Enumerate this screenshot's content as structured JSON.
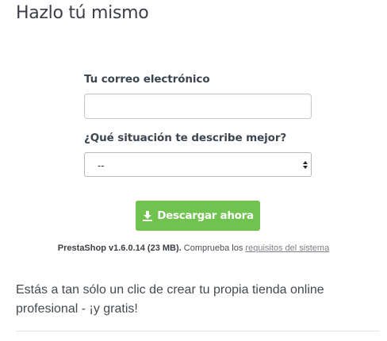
{
  "page": {
    "title": "Hazlo tú mismo"
  },
  "form": {
    "email_label": "Tu correo electrónico",
    "email_value": "",
    "email_placeholder": "",
    "situation_label": "¿Qué situación te describe mejor?",
    "situation_selected": "--"
  },
  "download": {
    "button_label": "Descargar ahora",
    "icon": "download-icon",
    "accent_color": "#6fc34e"
  },
  "meta": {
    "version": "PrestaShop v1.6.0.14 (23 MB).",
    "check_text": "Comprueba los",
    "requirements_link": "requisitos del sistema"
  },
  "promo": {
    "text": "Estás a tan sólo un clic de crear tu propia tienda online profesional - ¡y gratis!"
  }
}
